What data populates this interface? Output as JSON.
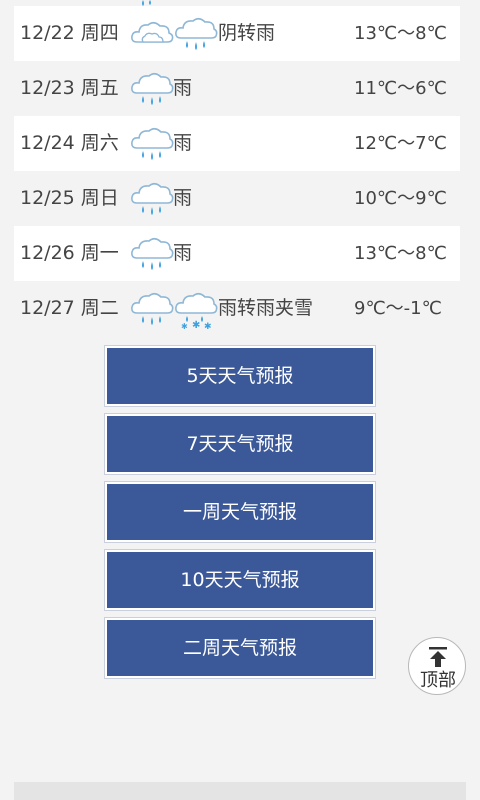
{
  "forecast": [
    {
      "date": "12/22 周四",
      "condition": "阴转雨",
      "temp": "13℃～8℃",
      "icons": [
        "cloudy-icon",
        "rain-icon"
      ]
    },
    {
      "date": "12/23 周五",
      "condition": "雨",
      "temp": "11℃～6℃",
      "icons": [
        "rain-icon"
      ]
    },
    {
      "date": "12/24 周六",
      "condition": "雨",
      "temp": "12℃～7℃",
      "icons": [
        "rain-icon"
      ]
    },
    {
      "date": "12/25 周日",
      "condition": "雨",
      "temp": "10℃～9℃",
      "icons": [
        "rain-icon"
      ]
    },
    {
      "date": "12/26 周一",
      "condition": "雨",
      "temp": "13℃～8℃",
      "icons": [
        "rain-icon"
      ]
    },
    {
      "date": "12/27 周二",
      "condition": "雨转雨夹雪",
      "temp": "9℃～-1℃",
      "icons": [
        "rain-icon",
        "sleet-icon"
      ]
    }
  ],
  "buttons": {
    "five_day": "5天天气预报",
    "seven_day": "7天天气预报",
    "one_week": "一周天气预报",
    "ten_day": "10天天气预报",
    "two_week": "二周天气预报"
  },
  "to_top": {
    "label": "顶部"
  },
  "colors": {
    "button_bg": "#3b5998",
    "row_white": "#ffffff",
    "page_bg": "#f3f3f3",
    "icon_blue": "#3fa2e0"
  }
}
